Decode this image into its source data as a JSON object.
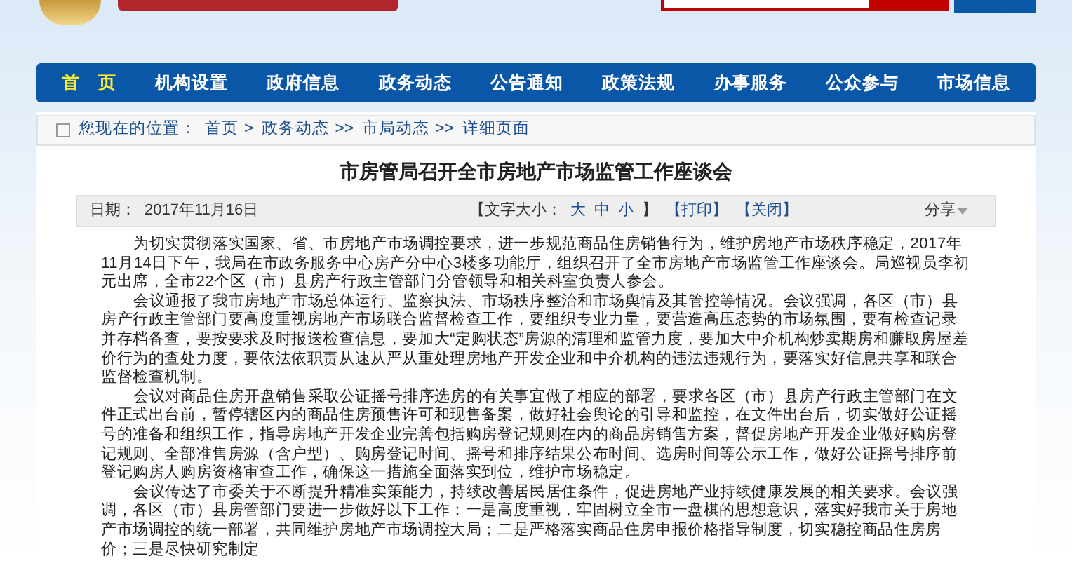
{
  "nav": {
    "items": [
      {
        "label": "首　页",
        "selected": true
      },
      {
        "label": "机构设置",
        "selected": false
      },
      {
        "label": "政府信息",
        "selected": false
      },
      {
        "label": "政务动态",
        "selected": false
      },
      {
        "label": "公告通知",
        "selected": false
      },
      {
        "label": "政策法规",
        "selected": false
      },
      {
        "label": "办事服务",
        "selected": false
      },
      {
        "label": "公众参与",
        "selected": false
      },
      {
        "label": "市场信息",
        "selected": false
      }
    ]
  },
  "breadcrumb": {
    "prefix": "您现在的位置：",
    "links": [
      "首页",
      "政务动态",
      "市局动态"
    ],
    "separators": [
      ">",
      ">>",
      ">>"
    ],
    "current": "详细页面"
  },
  "article": {
    "title": "市房管局召开全市房地产市场监管工作座谈会",
    "date_label": "日期：",
    "date": "2017年11月16日",
    "font_size": {
      "label": "【文字大小：",
      "options": [
        "大",
        "中",
        "小"
      ],
      "close": "】"
    },
    "actions": [
      "【打印】",
      "【关闭】"
    ],
    "share": "分享",
    "paragraphs": [
      "为切实贯彻落实国家、省、市房地产市场调控要求，进一步规范商品住房销售行为，维护房地产市场秩序稳定，2017年11月14日下午，我局在市政务服务中心房产分中心3楼多功能厅，组织召开了全市房地产市场监管工作座谈会。局巡视员李初元出席，全市22个区（市）县房产行政主管部门分管领导和相关科室负责人参会。",
      "会议通报了我市房地产市场总体运行、监察执法、市场秩序整治和市场舆情及其管控等情况。会议强调，各区（市）县房产行政主管部门要高度重视房地产市场联合监督检查工作，要组织专业力量，要营造高压态势的市场氛围，要有检查记录并存档备查，要按要求及时报送检查信息，要加大“定购状态”房源的清理和监管力度，要加大中介机构炒卖期房和赚取房屋差价行为的查处力度，要依法依职责从速从严从重处理房地产开发企业和中介机构的违法违规行为，要落实好信息共享和联合监督检查机制。",
      "会议对商品住房开盘销售采取公证摇号排序选房的有关事宜做了相应的部署，要求各区（市）县房产行政主管部门在文件正式出台前，暂停辖区内的商品住房预售许可和现售备案，做好社会舆论的引导和监控，在文件出台后，切实做好公证摇号的准备和组织工作，指导房地产开发企业完善包括购房登记规则在内的商品房销售方案，督促房地产开发企业做好购房登记规则、全部准售房源（含户型）、购房登记时间、摇号和排序结果公布时间、选房时间等公示工作，做好公证摇号排序前登记购房人购房资格审查工作，确保这一措施全面落实到位，维护市场稳定。",
      "会议传达了市委关于不断提升精准实策能力，持续改善居民居住条件，促进房地产业持续健康发展的相关要求。会议强调，各区（市）县房管部门要进一步做好以下工作：一是高度重视，牢固树立全市一盘棋的思想意识，落实好我市关于房地产市场调控的统一部署，共同维护房地产市场调控大局；二是严格落实商品住房申报价格指导制度，切实稳控商品住房房价；三是尽快研究制定"
    ]
  }
}
